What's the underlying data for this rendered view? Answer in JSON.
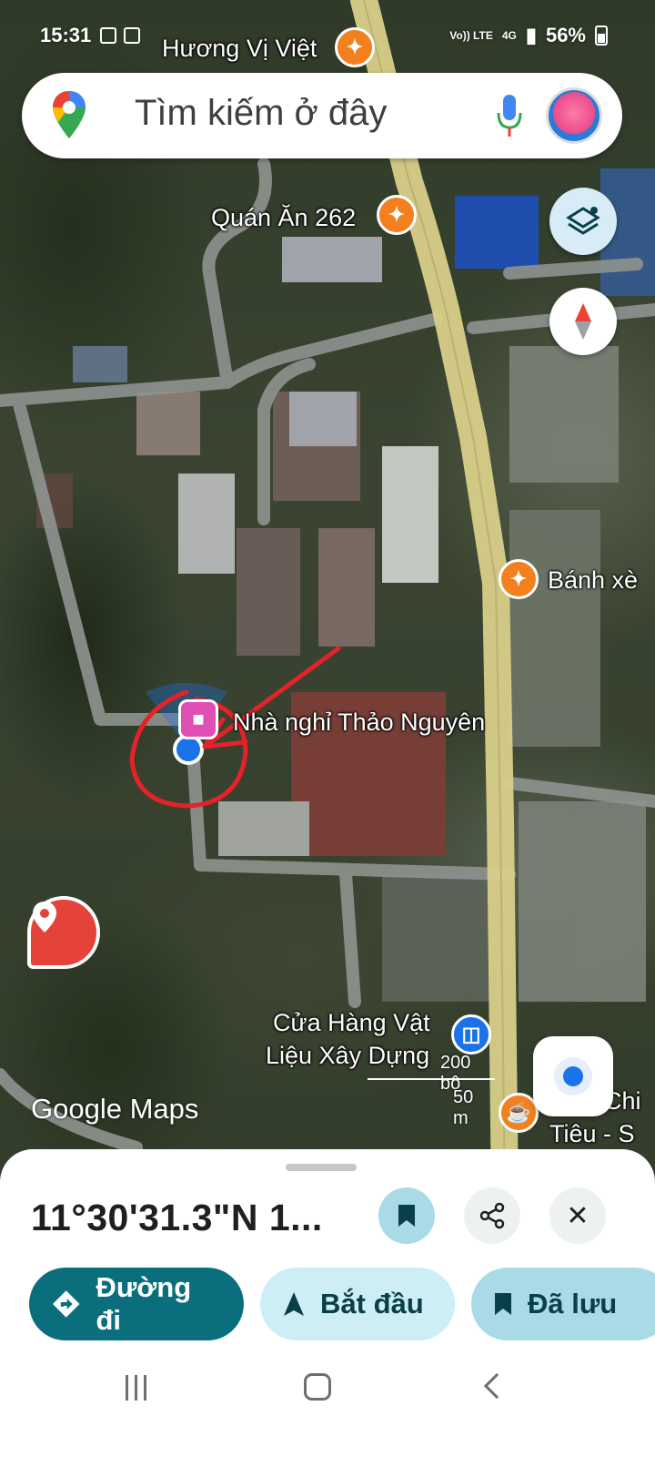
{
  "status_bar": {
    "time": "15:31",
    "battery": "56%",
    "network": "4G",
    "volte": "Vo)) LTE"
  },
  "search": {
    "placeholder": "Tìm kiếm ở đây"
  },
  "map": {
    "labels": {
      "restaurant_top": "Hương Vị Việt",
      "restaurant_262": "Quán Ăn 262",
      "banh_xeo": "Bánh xè",
      "guesthouse": "Nhà nghỉ Thảo Nguyên",
      "hardware_store_line1": "Cửa Hàng Vật",
      "hardware_store_line2": "Liệu Xây Dựng",
      "cafe_line1": "Chi",
      "cafe_line2": "Tiêu - S"
    },
    "scale": {
      "feet": "200 bộ",
      "meters": "50 m"
    },
    "attribution": "Google Maps"
  },
  "place": {
    "coordinates": "11°30'31.3\"N 1..."
  },
  "actions": {
    "directions": "Đường đi",
    "start": "Bắt đầu",
    "saved": "Đã lưu"
  },
  "icons": {
    "maps_logo": "google-maps-pin-logo",
    "mic": "mic-icon",
    "layers": "layers-icon",
    "compass": "compass-icon",
    "my_location": "my-location-icon",
    "dropped_pin": "map-pin-icon",
    "share": "share-icon",
    "close": "close-icon",
    "bookmark": "bookmark-icon",
    "directions": "directions-icon",
    "navigate": "navigation-arrow-icon"
  },
  "colors": {
    "accent_teal": "#0b6e7c",
    "light_teal": "#cdeef4",
    "road_main": "#d9cf8a",
    "poi_food": "#f2801e",
    "poi_lodging": "#e04fb3",
    "annotation_red": "#e3222a",
    "location_blue": "#1a73e8"
  }
}
